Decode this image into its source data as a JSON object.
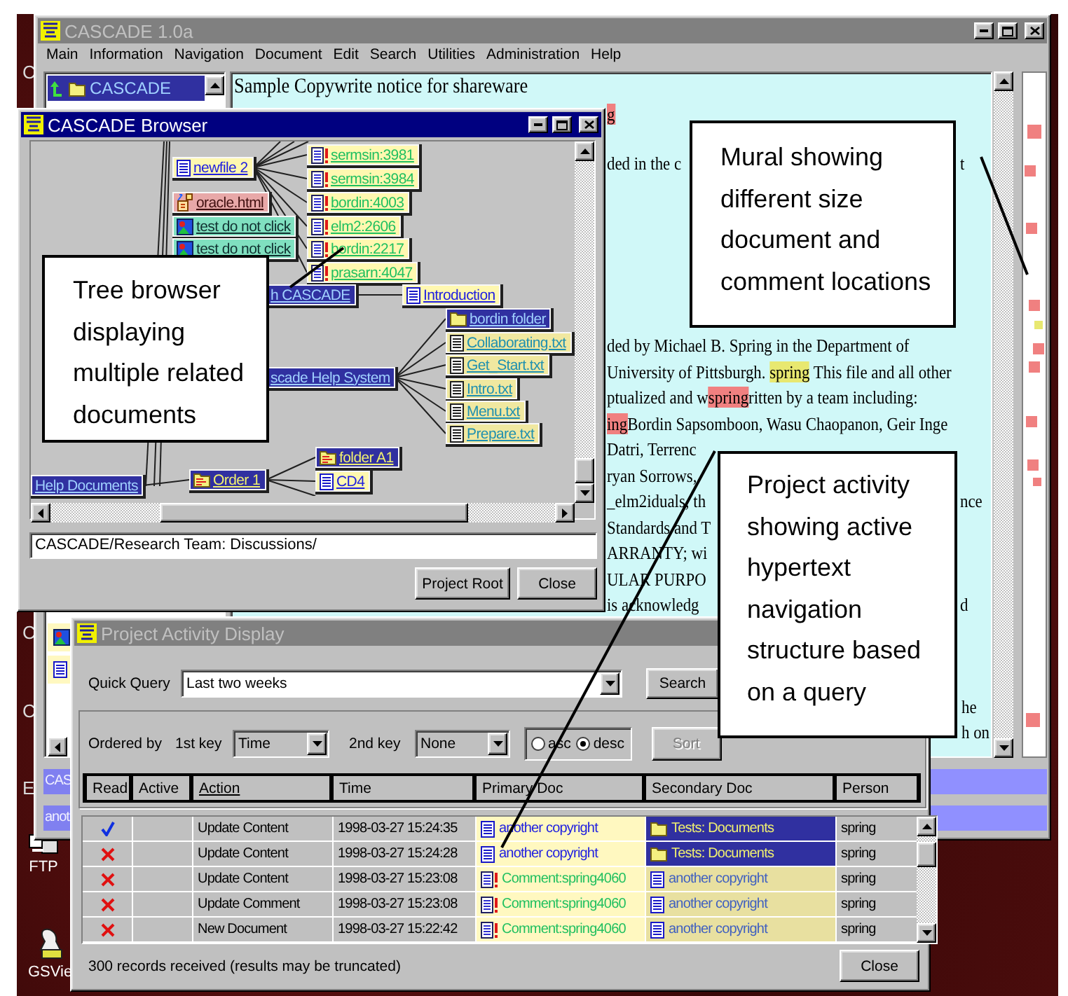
{
  "desktop": {
    "edge_labels": [
      "C",
      "C",
      "C",
      "E"
    ],
    "icons": [
      {
        "label": "FTP",
        "kind": "ftp"
      },
      {
        "label": "GSVie",
        "kind": "viewer"
      }
    ]
  },
  "main_window": {
    "title": "CASCADE 1.0a",
    "active": false,
    "menu": [
      "Main",
      "Information",
      "Navigation",
      "Document",
      "Edit",
      "Search",
      "Utilities",
      "Administration",
      "Help"
    ],
    "left_panel": {
      "items": [
        {
          "label": "CASCADE",
          "selected": true
        }
      ]
    },
    "document": {
      "top_lines": [
        {
          "segments": [
            {
              "text": "Sample Copywrite notice for shareware"
            }
          ]
        },
        {
          "segments": [
            {
              "text": "g",
              "color": "#f08080"
            }
          ]
        },
        {
          "segments": [
            {
              "text": "ded in the c"
            }
          ],
          "tail": "t"
        }
      ],
      "middle_lines": [
        {
          "segments": [
            {
              "text": "ded by Michael B. Spring in the Department of"
            }
          ]
        },
        {
          "segments": [
            {
              "text": "University of Pittsburgh. "
            },
            {
              "text": "spring",
              "color": "#e8e870"
            },
            {
              "text": " This file and all other"
            }
          ]
        },
        {
          "segments": [
            {
              "text": "ptualized and w"
            },
            {
              "text": "spring",
              "color": "#f08080"
            },
            {
              "text": "ritten by a team including:"
            }
          ]
        },
        {
          "segments": [
            {
              "text": "ing",
              "color": "#f08080"
            },
            {
              "text": "Bordin Sapsomboon, Wasu Chaopanon, Geir Inge"
            }
          ]
        },
        {
          "segments": [
            {
              "text": "Datri, Terrenc"
            }
          ]
        },
        {
          "segments": [
            {
              "text": "ryan Sorrows,"
            }
          ]
        },
        {
          "segments": [
            {
              "text": "_elm2iduals, th"
            }
          ],
          "tail": "nce"
        },
        {
          "segments": [
            {
              "text": "Standards and T"
            }
          ]
        },
        {
          "segments": [
            {
              "text": "ARRANTY; wi"
            }
          ]
        },
        {
          "segments": [
            {
              "text": "ULAR PURPO"
            }
          ]
        },
        {
          "segments": [
            {
              "text": "is acknowledg"
            }
          ],
          "tail": "d"
        }
      ],
      "bottom_lines": [
        {
          "segments": [
            {
              "text": "he"
            }
          ]
        },
        {
          "segments": [
            {
              "text": "h on"
            }
          ]
        }
      ]
    },
    "bottom_rows": [
      {
        "label": "CAS"
      },
      {
        "label": "anot"
      }
    ]
  },
  "browser_window": {
    "title": "CASCADE Browser",
    "active": true,
    "nodes": [
      {
        "label": "newfile 2",
        "kind": "document"
      },
      {
        "label": "sermsin:3981",
        "kind": "comment"
      },
      {
        "label": "sermsin:3984",
        "kind": "comment"
      },
      {
        "label": "oracle.html",
        "kind": "html"
      },
      {
        "label": "bordin:4003",
        "kind": "comment"
      },
      {
        "label": "test do not click",
        "kind": "picture"
      },
      {
        "label": "elm2:2606",
        "kind": "comment"
      },
      {
        "label": "test do not click",
        "kind": "picture"
      },
      {
        "label": "bordin:2217",
        "kind": "comment"
      },
      {
        "label": "prasarn:4047",
        "kind": "comment"
      },
      {
        "label": "h CASCADE",
        "kind": "group"
      },
      {
        "label": "Introduction",
        "kind": "document"
      },
      {
        "label": "bordin folder",
        "kind": "folder"
      },
      {
        "label": "Collaborating.txt",
        "kind": "text"
      },
      {
        "label": "Get_Start.txt",
        "kind": "text"
      },
      {
        "label": "Intro.txt",
        "kind": "text"
      },
      {
        "label": "Menu.txt",
        "kind": "text"
      },
      {
        "label": "Prepare.txt",
        "kind": "text"
      },
      {
        "label": "scade Help System",
        "kind": "group"
      },
      {
        "label": "folder A1",
        "kind": "order"
      },
      {
        "label": "Help Documents",
        "kind": "group"
      },
      {
        "label": "Order 1",
        "kind": "order"
      },
      {
        "label": "CD4",
        "kind": "document"
      }
    ],
    "path": "CASCADE/Research Team: Discussions/",
    "buttons": [
      "Project Root",
      "Close"
    ]
  },
  "activity_window": {
    "title": "Project Activity Display",
    "active": false,
    "quick_query": {
      "label": "Quick Query",
      "value": "Last two weeks"
    },
    "search_button": "Search",
    "sort": {
      "label": "Ordered by",
      "first_key": {
        "label": "1st key",
        "value": "Time"
      },
      "second_key": {
        "label": "2nd key",
        "value": "None"
      },
      "direction": [
        {
          "label": "asc",
          "selected": false
        },
        {
          "label": "desc",
          "selected": true
        }
      ],
      "sort_button": {
        "label": "Sort",
        "disabled": true
      }
    },
    "columns": [
      {
        "label": "Read",
        "sorted": false
      },
      {
        "label": "Active",
        "sorted": false
      },
      {
        "label": "Action",
        "sorted": true
      },
      {
        "label": "Time",
        "sorted": false
      },
      {
        "label": "Primary Doc",
        "sorted": false
      },
      {
        "label": "Secondary Doc",
        "sorted": false
      },
      {
        "label": "Person",
        "sorted": false
      }
    ],
    "rows": [
      {
        "read": true,
        "action": "Update Content",
        "time": "1998-03-27 15:24:35",
        "primary": {
          "label": "another copyright",
          "kind": "document"
        },
        "secondary": {
          "label": "Tests: Documents",
          "kind": "folder"
        },
        "person": "spring"
      },
      {
        "read": false,
        "action": "Update Content",
        "time": "1998-03-27 15:24:28",
        "primary": {
          "label": "another copyright",
          "kind": "document"
        },
        "secondary": {
          "label": "Tests: Documents",
          "kind": "folder"
        },
        "person": "spring"
      },
      {
        "read": false,
        "action": "Update Content",
        "time": "1998-03-27 15:23:08",
        "primary": {
          "label": "Comment:spring4060",
          "kind": "comment"
        },
        "secondary": {
          "label": "another copyright",
          "kind": "document"
        },
        "person": "spring"
      },
      {
        "read": false,
        "action": "Update Comment",
        "time": "1998-03-27 15:23:08",
        "primary": {
          "label": "Comment:spring4060",
          "kind": "comment"
        },
        "secondary": {
          "label": "another copyright",
          "kind": "document"
        },
        "person": "spring"
      },
      {
        "read": false,
        "action": "New Document",
        "time": "1998-03-27 15:22:42",
        "primary": {
          "label": "Comment:spring4060",
          "kind": "comment"
        },
        "secondary": {
          "label": "another copyright",
          "kind": "document"
        },
        "person": "spring"
      }
    ],
    "status": "300 records received (results may be truncated)",
    "close_button": "Close"
  },
  "callouts": [
    {
      "text": "Tree browser displaying multiple related documents"
    },
    {
      "text": "Mural showing different size document and comment locations"
    },
    {
      "text": "Project activity showing active hypertext navigation structure based on a query"
    }
  ]
}
